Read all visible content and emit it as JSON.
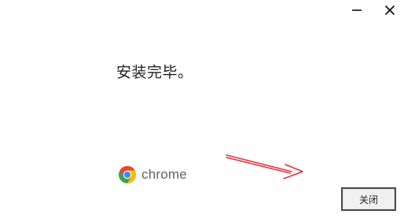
{
  "window_controls": {
    "minimize_icon": "minimize-icon",
    "close_icon": "close-icon"
  },
  "message": {
    "text": "安装完毕。"
  },
  "brand": {
    "logo_icon": "chrome-logo-icon",
    "name": "chrome"
  },
  "annotation": {
    "arrow_icon": "red-arrow-icon",
    "arrow_color": "#e8313a"
  },
  "footer": {
    "close_label": "关闭"
  },
  "colors": {
    "chrome_red": "#ea4335",
    "chrome_yellow": "#fbbc05",
    "chrome_green": "#34a853",
    "chrome_blue": "#4285f4"
  }
}
